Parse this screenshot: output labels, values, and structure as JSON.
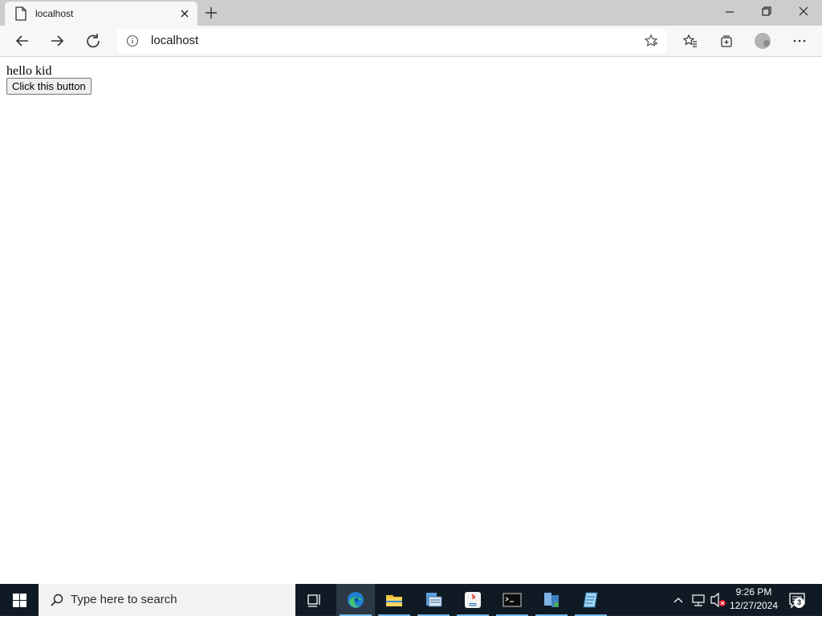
{
  "browser": {
    "tab": {
      "title": "localhost"
    },
    "address_bar": {
      "url": "localhost"
    }
  },
  "page": {
    "text": "hello kid",
    "button_label": "Click this button"
  },
  "taskbar": {
    "search_placeholder": "Type here to search",
    "clock": {
      "time": "9:26 PM",
      "date": "12/27/2024"
    },
    "notification_count": "3",
    "pinned_apps": [
      "task-view",
      "edge",
      "file-explorer",
      "server-manager",
      "java",
      "command-prompt",
      "cluster-manager",
      "notes"
    ]
  },
  "colors": {
    "tabstrip_bg": "#cdcdcd",
    "toolbar_bg": "#f7f7f7",
    "taskbar_bg": "#101a24",
    "active_indicator": "#76b9ed"
  }
}
